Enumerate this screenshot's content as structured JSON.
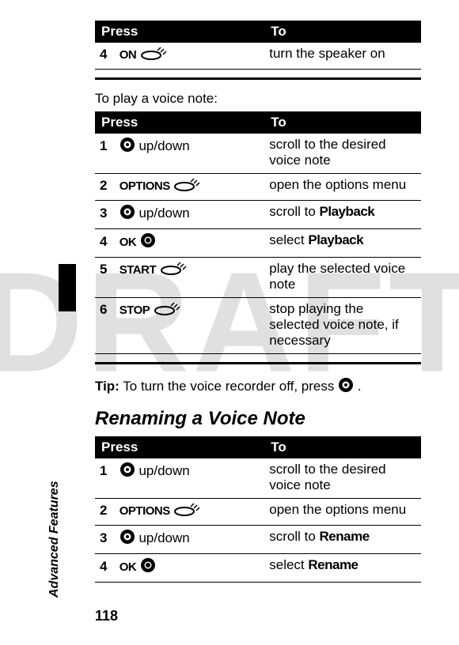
{
  "watermark": "DRAFT",
  "sidebar_label": "Advanced Features",
  "page_number": "118",
  "table_headers": {
    "press": "Press",
    "to": "To"
  },
  "table1": {
    "rows": [
      {
        "num": "4",
        "key": "ON",
        "icon": "softkey",
        "to": "turn the speaker on"
      }
    ]
  },
  "intro2": "To play a voice note:",
  "table2": {
    "rows": [
      {
        "num": "1",
        "key": "",
        "icon": "nav",
        "after": " up/down",
        "to": "scroll to the desired voice note"
      },
      {
        "num": "2",
        "key": "OPTIONS",
        "icon": "softkey",
        "after": "",
        "to": "open the options menu"
      },
      {
        "num": "3",
        "key": "",
        "icon": "nav",
        "after": " up/down",
        "to_pre": "scroll to ",
        "to_bold": "Playback"
      },
      {
        "num": "4",
        "key": "OK",
        "icon": "center",
        "after": "",
        "to_pre": "select ",
        "to_bold": "Playback"
      },
      {
        "num": "5",
        "key": "START",
        "icon": "softkey",
        "after": "",
        "to": "play the selected voice note"
      },
      {
        "num": "6",
        "key": "STOP",
        "icon": "softkey",
        "after": "",
        "to": "stop playing the selected voice note, if necessary"
      }
    ]
  },
  "tip": {
    "label": "Tip:",
    "pre": " To turn the voice recorder off, press ",
    "post": " ."
  },
  "section_heading": "Renaming a Voice Note",
  "table3": {
    "rows": [
      {
        "num": "1",
        "key": "",
        "icon": "nav",
        "after": " up/down",
        "to": "scroll to the desired voice note"
      },
      {
        "num": "2",
        "key": "OPTIONS",
        "icon": "softkey",
        "after": "",
        "to": "open the options menu"
      },
      {
        "num": "3",
        "key": "",
        "icon": "nav",
        "after": " up/down",
        "to_pre": "scroll to ",
        "to_bold": "Rename"
      },
      {
        "num": "4",
        "key": "OK",
        "icon": "center",
        "after": "",
        "to_pre": "select ",
        "to_bold": "Rename"
      }
    ]
  }
}
